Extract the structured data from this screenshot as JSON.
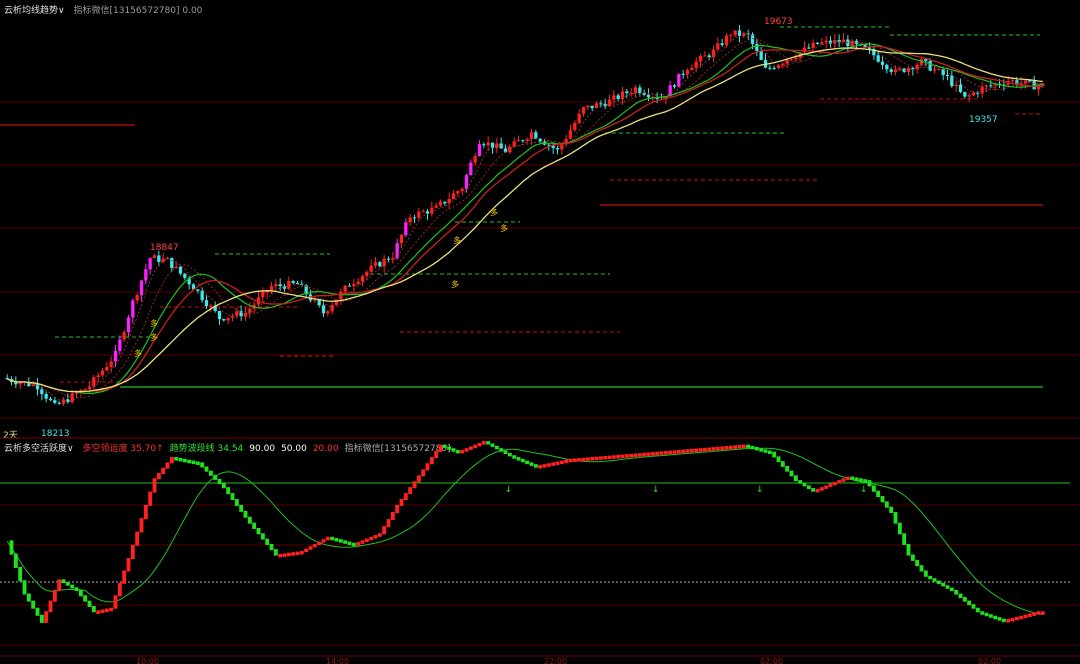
{
  "colors": {
    "up": "#ff2020",
    "down": "#3ee8e8",
    "strong_up": "#ff20ff",
    "ma_yellow": "#e8e080",
    "ma_red": "#c82020",
    "ma_green": "#20c020",
    "grid_red": "#5a0000",
    "level_green": "#20c020",
    "osc_red": "#ff2020",
    "osc_green": "#20e020",
    "signal_line": "#20c020"
  },
  "top_panel": {
    "title": "云析均线趋势",
    "dropdown": "∨",
    "subtitle": "指标微信[13156572780] 0.00",
    "period_label": "2天",
    "peak_labels": {
      "high_1": "18847",
      "high_2": "19673",
      "low_1": "18213",
      "low_2": "19357"
    },
    "duo_marker": "多"
  },
  "bottom_panel": {
    "title": "云析多空活跃度",
    "dropdown": "∨",
    "items": [
      {
        "text": "多空领运度 35.70↑",
        "color": "#ff3030"
      },
      {
        "text": "趋势波段线 34.54",
        "color": "#30e030"
      },
      {
        "text": "90.00",
        "color": "#ffffff"
      },
      {
        "text": "50.00",
        "color": "#ffffff"
      },
      {
        "text": "20.00",
        "color": "#ff3030"
      },
      {
        "text": "指标微信[13156572780]",
        "color": "#aaaaaa"
      }
    ]
  },
  "chart_data": {
    "type": "candlestick+oscillator",
    "price_axis": "none shown",
    "time_labels": [
      "10:00",
      "14:00",
      "22:00",
      "02:00",
      "02:00"
    ],
    "annotations": {
      "highs": [
        18847,
        19673
      ],
      "lows": [
        18213,
        19357
      ]
    },
    "price_path": [
      {
        "i": 0,
        "p": 18330
      },
      {
        "i": 8,
        "p": 18300
      },
      {
        "i": 12,
        "p": 18220
      },
      {
        "i": 20,
        "p": 18300
      },
      {
        "i": 26,
        "p": 18420
      },
      {
        "i": 30,
        "p": 18620
      },
      {
        "i": 34,
        "p": 18790
      },
      {
        "i": 38,
        "p": 18780
      },
      {
        "i": 44,
        "p": 18680
      },
      {
        "i": 50,
        "p": 18560
      },
      {
        "i": 56,
        "p": 18580
      },
      {
        "i": 62,
        "p": 18680
      },
      {
        "i": 68,
        "p": 18690
      },
      {
        "i": 74,
        "p": 18580
      },
      {
        "i": 80,
        "p": 18690
      },
      {
        "i": 86,
        "p": 18760
      },
      {
        "i": 90,
        "p": 18800
      },
      {
        "i": 94,
        "p": 18950
      },
      {
        "i": 100,
        "p": 18980
      },
      {
        "i": 106,
        "p": 19060
      },
      {
        "i": 110,
        "p": 19240
      },
      {
        "i": 116,
        "p": 19200
      },
      {
        "i": 122,
        "p": 19270
      },
      {
        "i": 128,
        "p": 19200
      },
      {
        "i": 134,
        "p": 19360
      },
      {
        "i": 140,
        "p": 19390
      },
      {
        "i": 146,
        "p": 19440
      },
      {
        "i": 152,
        "p": 19400
      },
      {
        "i": 158,
        "p": 19520
      },
      {
        "i": 164,
        "p": 19580
      },
      {
        "i": 168,
        "p": 19650
      },
      {
        "i": 172,
        "p": 19640
      },
      {
        "i": 176,
        "p": 19510
      },
      {
        "i": 182,
        "p": 19560
      },
      {
        "i": 188,
        "p": 19610
      },
      {
        "i": 194,
        "p": 19620
      },
      {
        "i": 200,
        "p": 19580
      },
      {
        "i": 206,
        "p": 19500
      },
      {
        "i": 212,
        "p": 19540
      },
      {
        "i": 218,
        "p": 19480
      },
      {
        "i": 222,
        "p": 19400
      },
      {
        "i": 226,
        "p": 19440
      },
      {
        "i": 232,
        "p": 19470
      },
      {
        "i": 238,
        "p": 19450
      }
    ],
    "oscillator": {
      "levels": [
        90,
        50,
        20
      ],
      "active_path": [
        {
          "i": 0,
          "v": 50
        },
        {
          "i": 4,
          "v": 20
        },
        {
          "i": 8,
          "v": 4
        },
        {
          "i": 12,
          "v": 28
        },
        {
          "i": 16,
          "v": 22
        },
        {
          "i": 20,
          "v": 10
        },
        {
          "i": 24,
          "v": 12
        },
        {
          "i": 28,
          "v": 40
        },
        {
          "i": 34,
          "v": 85
        },
        {
          "i": 38,
          "v": 97
        },
        {
          "i": 44,
          "v": 94
        },
        {
          "i": 50,
          "v": 80
        },
        {
          "i": 56,
          "v": 60
        },
        {
          "i": 62,
          "v": 42
        },
        {
          "i": 68,
          "v": 44
        },
        {
          "i": 74,
          "v": 52
        },
        {
          "i": 80,
          "v": 48
        },
        {
          "i": 86,
          "v": 54
        },
        {
          "i": 90,
          "v": 70
        },
        {
          "i": 96,
          "v": 90
        },
        {
          "i": 100,
          "v": 104
        },
        {
          "i": 104,
          "v": 100
        },
        {
          "i": 110,
          "v": 106
        },
        {
          "i": 116,
          "v": 98
        },
        {
          "i": 122,
          "v": 92
        },
        {
          "i": 130,
          "v": 96
        },
        {
          "i": 140,
          "v": 98
        },
        {
          "i": 150,
          "v": 100
        },
        {
          "i": 160,
          "v": 102
        },
        {
          "i": 170,
          "v": 104
        },
        {
          "i": 176,
          "v": 100
        },
        {
          "i": 182,
          "v": 84
        },
        {
          "i": 186,
          "v": 78
        },
        {
          "i": 190,
          "v": 82
        },
        {
          "i": 194,
          "v": 86
        },
        {
          "i": 198,
          "v": 84
        },
        {
          "i": 204,
          "v": 66
        },
        {
          "i": 208,
          "v": 42
        },
        {
          "i": 212,
          "v": 30
        },
        {
          "i": 218,
          "v": 22
        },
        {
          "i": 224,
          "v": 10
        },
        {
          "i": 230,
          "v": 5
        },
        {
          "i": 238,
          "v": 10
        }
      ],
      "signal_lag": 9,
      "down_arrows_at": [
        116,
        150,
        174,
        198
      ]
    }
  }
}
